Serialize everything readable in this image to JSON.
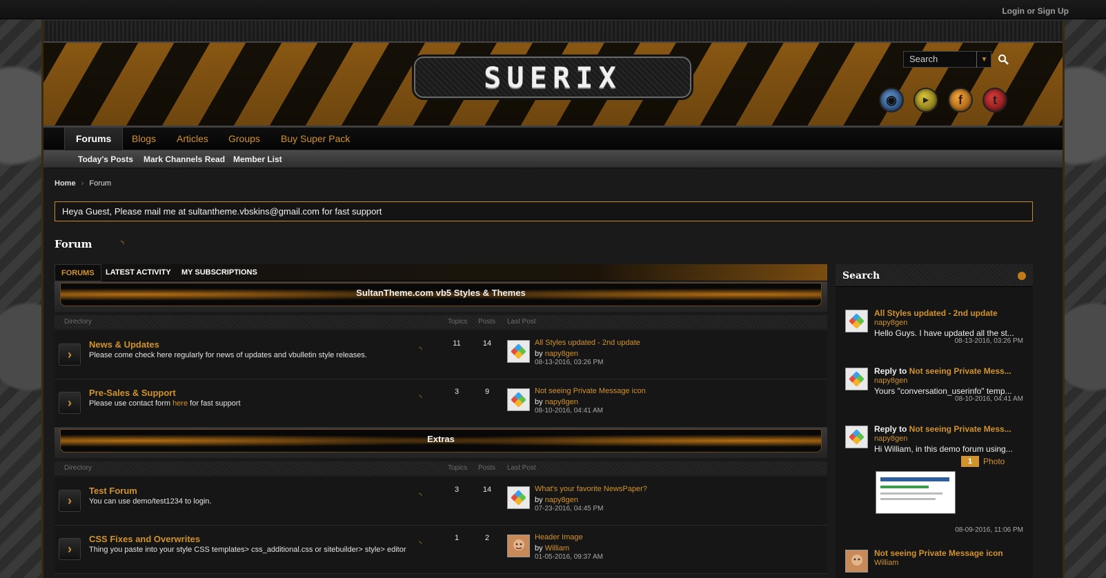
{
  "topbar": {
    "login_label": "Login or Sign Up"
  },
  "header": {
    "logo_text": "SUERIX",
    "search_placeholder": "Search",
    "social": [
      "rss-icon",
      "youtube-icon",
      "facebook-icon",
      "twitter-icon"
    ]
  },
  "nav": {
    "items": [
      {
        "label": "Forums"
      },
      {
        "label": "Blogs"
      },
      {
        "label": "Articles"
      },
      {
        "label": "Groups"
      },
      {
        "label": "Buy Super Pack"
      }
    ]
  },
  "subnav": {
    "items": [
      {
        "label": "Today's Posts"
      },
      {
        "label": "Mark Channels Read"
      },
      {
        "label": "Member List"
      }
    ]
  },
  "breadcrumb": {
    "home": "Home",
    "current": "Forum"
  },
  "notice": {
    "text": "Heya Guest, Please mail me at sultantheme.vbskins@gmail.com for fast support"
  },
  "page": {
    "title": "Forum"
  },
  "tabs": [
    {
      "label": "FORUMS"
    },
    {
      "label": "LATEST ACTIVITY"
    },
    {
      "label": "MY SUBSCRIPTIONS"
    }
  ],
  "columns": {
    "directory": "Directory",
    "topics": "Topics",
    "posts": "Posts",
    "last_post": "Last Post"
  },
  "categories": [
    {
      "title": "SultanTheme.com vb5 Styles & Themes",
      "forums": [
        {
          "title": "News & Updates",
          "desc": "Please come check here regularly for news of updates and vbulletin style releases.",
          "topics": "11",
          "posts": "14",
          "last_title": "All Styles updated - 2nd update",
          "last_by": "by",
          "last_user": "napy8gen",
          "last_date": "08-13-2016, 03:26 PM"
        },
        {
          "title": "Pre-Sales & Support",
          "desc_pre": "Please use contact form ",
          "desc_link": "here",
          "desc_post": " for fast support",
          "topics": "3",
          "posts": "9",
          "last_title": "Not seeing Private Message icon",
          "last_by": "by",
          "last_user": "napy8gen",
          "last_date": "08-10-2016, 04:41 AM"
        }
      ]
    },
    {
      "title": "Extras",
      "forums": [
        {
          "title": "Test Forum",
          "desc": "You can use demo/test1234 to login.",
          "topics": "3",
          "posts": "14",
          "last_title": "What's your favorite NewsPaper?",
          "last_by": "by",
          "last_user": "napy8gen",
          "last_date": "07-23-2016, 04:45 PM"
        },
        {
          "title": "CSS Fixes and Overwrites",
          "desc": "Thing you paste into your style CSS templates> css_additional.css or sitebuilder> style> editor",
          "topics": "1",
          "posts": "2",
          "last_title": "Header Image",
          "last_by": "by",
          "last_user": "William",
          "last_date": "01-05-2016, 09:37 AM"
        }
      ]
    }
  ],
  "sidebar": {
    "title": "Search",
    "items": [
      {
        "prefix": "",
        "title": "All Styles updated - 2nd update",
        "user": "napy8gen",
        "text": "Hello Guys. I have updated all the st...",
        "date": "08-13-2016, 03:26 PM"
      },
      {
        "prefix": "Reply to ",
        "title": "Not seeing Private Mess...",
        "user": "napy8gen",
        "text": "Yours \"conversation_userinfo\" temp...",
        "date": "08-10-2016, 04:41 AM"
      },
      {
        "prefix": "Reply to ",
        "title": "Not seeing Private Mess...",
        "user": "napy8gen",
        "text": "Hi William, in this demo forum using...",
        "photo_count": "1",
        "photo_label": "Photo",
        "date": "08-09-2016, 11:06 PM"
      },
      {
        "prefix": "",
        "title": "Not seeing Private Message icon",
        "user": "William"
      }
    ]
  }
}
